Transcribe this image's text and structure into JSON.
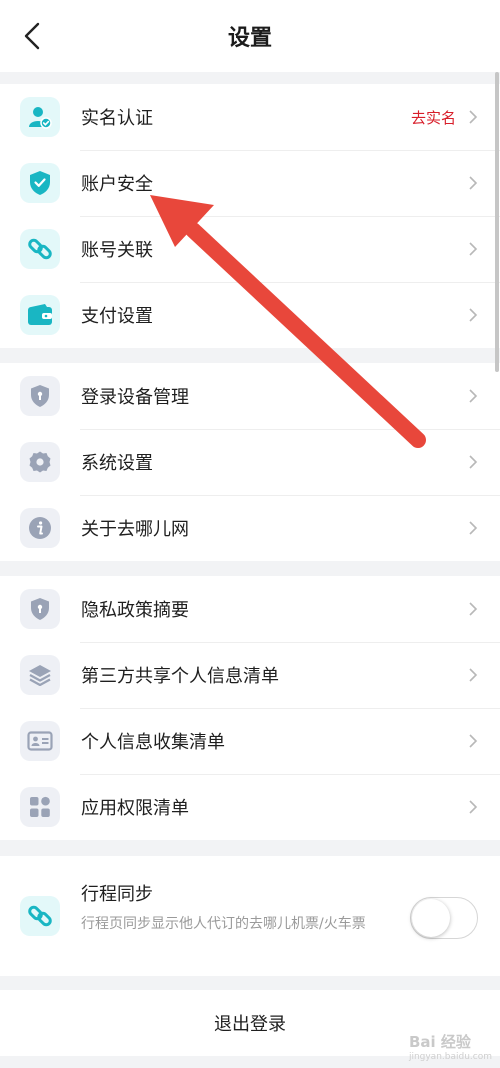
{
  "header": {
    "title": "设置",
    "back_icon": "chevron-left-icon"
  },
  "group1": [
    {
      "label": "实名认证",
      "icon": "user-verified-icon",
      "extra": "去实名"
    },
    {
      "label": "账户安全",
      "icon": "shield-check-icon"
    },
    {
      "label": "账号关联",
      "icon": "link-icon"
    },
    {
      "label": "支付设置",
      "icon": "wallet-icon"
    }
  ],
  "group2": [
    {
      "label": "登录设备管理",
      "icon": "shield-icon"
    },
    {
      "label": "系统设置",
      "icon": "gear-icon"
    },
    {
      "label": "关于去哪儿网",
      "icon": "info-icon"
    }
  ],
  "group3": [
    {
      "label": "隐私政策摘要",
      "icon": "shield-icon"
    },
    {
      "label": "第三方共享个人信息清单",
      "icon": "layers-icon"
    },
    {
      "label": "个人信息收集清单",
      "icon": "id-card-icon"
    },
    {
      "label": "应用权限清单",
      "icon": "grid-icon"
    }
  ],
  "sync": {
    "title": "行程同步",
    "description": "行程页同步显示他人代订的去哪儿机票/火车票",
    "icon": "link-icon",
    "enabled": false
  },
  "logout": {
    "label": "退出登录"
  },
  "watermark": {
    "text": "Bai 经验",
    "sub": "jingyan.baidu.com"
  },
  "colors": {
    "accent_teal": "#19b6c3",
    "extra_red": "#d81e2a",
    "arrow_red": "#e8473b"
  }
}
